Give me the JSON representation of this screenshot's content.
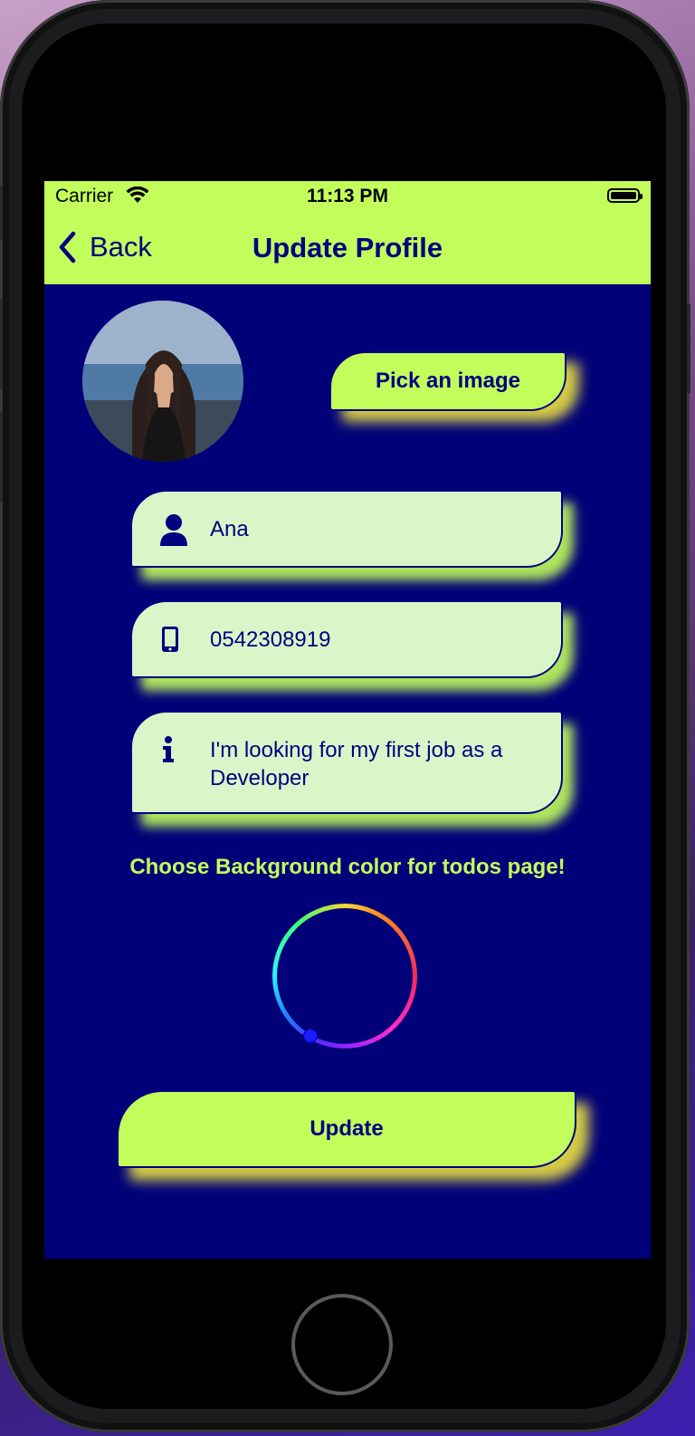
{
  "status_bar": {
    "carrier": "Carrier",
    "time": "11:13 PM"
  },
  "nav": {
    "back_label": "Back",
    "title": "Update Profile"
  },
  "profile": {
    "pick_image_label": "Pick an image",
    "name": "Ana",
    "phone": "0542308919",
    "bio": "I'm looking for my first job as a Developer"
  },
  "color_picker": {
    "label": "Choose Background color for todos page!"
  },
  "actions": {
    "update_label": "Update"
  },
  "colors": {
    "accent": "#c2fd5b",
    "background": "#000078",
    "text": "#000080",
    "field_fill": "#d9f6c9"
  },
  "icons": [
    "back-chevron-icon",
    "wifi-icon",
    "battery-icon",
    "user-icon",
    "phone-icon",
    "info-icon"
  ]
}
